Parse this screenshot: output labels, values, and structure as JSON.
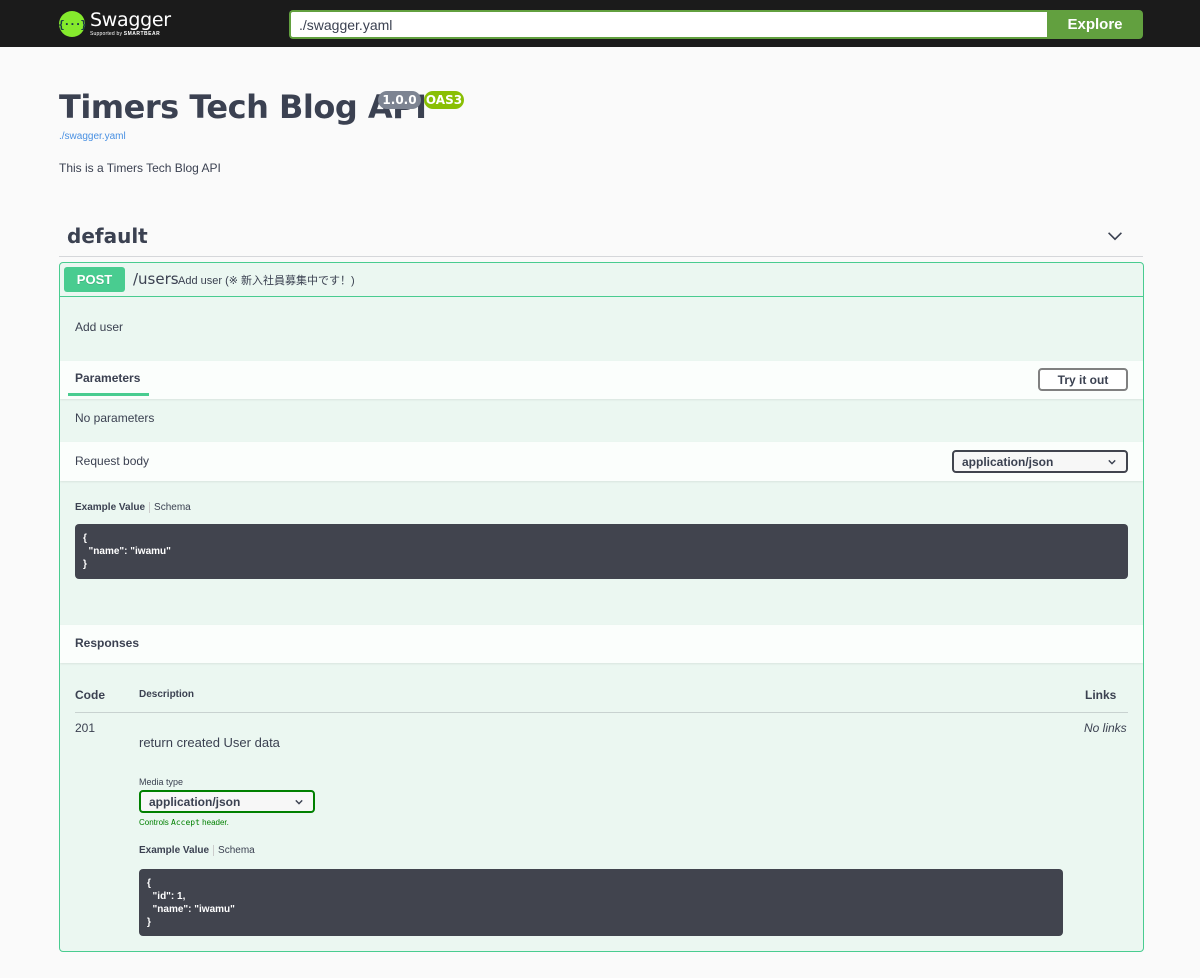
{
  "topbar": {
    "logo_title": "Swagger",
    "logo_sub_prefix": "Supported by",
    "logo_sub_brand": "SMARTBEAR",
    "logo_mark": "{···}",
    "url_value": "./swagger.yaml",
    "explore_label": "Explore"
  },
  "info": {
    "title": "Timers Tech Blog API",
    "version": "1.0.0",
    "oas": "OAS3",
    "spec_link": "./swagger.yaml",
    "description": "This is a Timers Tech Blog API"
  },
  "tag": {
    "name": "default",
    "toggle_icon": "chevron-down-icon"
  },
  "operation": {
    "method": "POST",
    "path": "/users",
    "summary": "Add user (※ 新入社員募集中です！)",
    "description": "Add user",
    "parameters_tab": "Parameters",
    "try_label": "Try it out",
    "no_params": "No parameters",
    "request_body_label": "Request body",
    "request_content_type": "application/json",
    "example_value_tab": "Example Value",
    "schema_tab": "Schema",
    "request_example": "{\n  \"name\": \"iwamu\"\n}"
  },
  "responses": {
    "title": "Responses",
    "col_code": "Code",
    "col_description": "Description",
    "col_links": "Links",
    "items": [
      {
        "code": "201",
        "description": "return created User data",
        "links": "No links",
        "media_type_label": "Media type",
        "media_type": "application/json",
        "controls_prefix": "Controls",
        "controls_code": "Accept",
        "controls_suffix": "header.",
        "example_value_tab": "Example Value",
        "schema_tab": "Schema",
        "example": "{\n  \"id\": 1,\n  \"name\": \"iwamu\"\n}"
      }
    ]
  },
  "colors": {
    "post_green": "#49cc90",
    "topbar_bg": "#1b1b1b",
    "explore_green": "#62a03f",
    "code_bg": "#41444e"
  }
}
